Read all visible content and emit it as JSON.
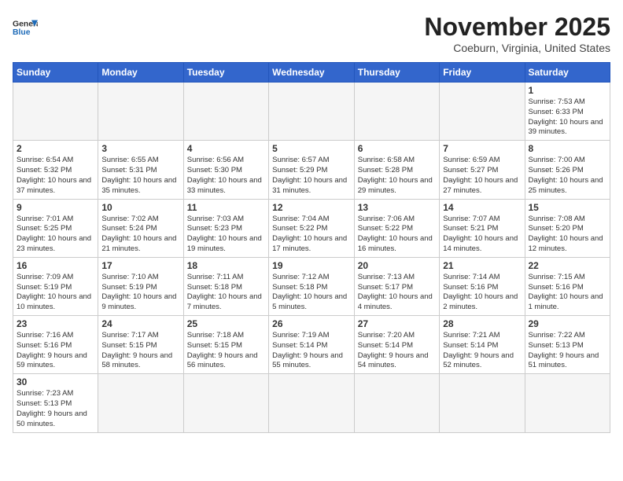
{
  "header": {
    "logo_general": "General",
    "logo_blue": "Blue",
    "month": "November 2025",
    "location": "Coeburn, Virginia, United States"
  },
  "weekdays": [
    "Sunday",
    "Monday",
    "Tuesday",
    "Wednesday",
    "Thursday",
    "Friday",
    "Saturday"
  ],
  "weeks": [
    [
      {
        "day": "",
        "info": ""
      },
      {
        "day": "",
        "info": ""
      },
      {
        "day": "",
        "info": ""
      },
      {
        "day": "",
        "info": ""
      },
      {
        "day": "",
        "info": ""
      },
      {
        "day": "",
        "info": ""
      },
      {
        "day": "1",
        "info": "Sunrise: 7:53 AM\nSunset: 6:33 PM\nDaylight: 10 hours\nand 39 minutes."
      }
    ],
    [
      {
        "day": "2",
        "info": "Sunrise: 6:54 AM\nSunset: 5:32 PM\nDaylight: 10 hours\nand 37 minutes."
      },
      {
        "day": "3",
        "info": "Sunrise: 6:55 AM\nSunset: 5:31 PM\nDaylight: 10 hours\nand 35 minutes."
      },
      {
        "day": "4",
        "info": "Sunrise: 6:56 AM\nSunset: 5:30 PM\nDaylight: 10 hours\nand 33 minutes."
      },
      {
        "day": "5",
        "info": "Sunrise: 6:57 AM\nSunset: 5:29 PM\nDaylight: 10 hours\nand 31 minutes."
      },
      {
        "day": "6",
        "info": "Sunrise: 6:58 AM\nSunset: 5:28 PM\nDaylight: 10 hours\nand 29 minutes."
      },
      {
        "day": "7",
        "info": "Sunrise: 6:59 AM\nSunset: 5:27 PM\nDaylight: 10 hours\nand 27 minutes."
      },
      {
        "day": "8",
        "info": "Sunrise: 7:00 AM\nSunset: 5:26 PM\nDaylight: 10 hours\nand 25 minutes."
      }
    ],
    [
      {
        "day": "9",
        "info": "Sunrise: 7:01 AM\nSunset: 5:25 PM\nDaylight: 10 hours\nand 23 minutes."
      },
      {
        "day": "10",
        "info": "Sunrise: 7:02 AM\nSunset: 5:24 PM\nDaylight: 10 hours\nand 21 minutes."
      },
      {
        "day": "11",
        "info": "Sunrise: 7:03 AM\nSunset: 5:23 PM\nDaylight: 10 hours\nand 19 minutes."
      },
      {
        "day": "12",
        "info": "Sunrise: 7:04 AM\nSunset: 5:22 PM\nDaylight: 10 hours\nand 17 minutes."
      },
      {
        "day": "13",
        "info": "Sunrise: 7:06 AM\nSunset: 5:22 PM\nDaylight: 10 hours\nand 16 minutes."
      },
      {
        "day": "14",
        "info": "Sunrise: 7:07 AM\nSunset: 5:21 PM\nDaylight: 10 hours\nand 14 minutes."
      },
      {
        "day": "15",
        "info": "Sunrise: 7:08 AM\nSunset: 5:20 PM\nDaylight: 10 hours\nand 12 minutes."
      }
    ],
    [
      {
        "day": "16",
        "info": "Sunrise: 7:09 AM\nSunset: 5:19 PM\nDaylight: 10 hours\nand 10 minutes."
      },
      {
        "day": "17",
        "info": "Sunrise: 7:10 AM\nSunset: 5:19 PM\nDaylight: 10 hours\nand 9 minutes."
      },
      {
        "day": "18",
        "info": "Sunrise: 7:11 AM\nSunset: 5:18 PM\nDaylight: 10 hours\nand 7 minutes."
      },
      {
        "day": "19",
        "info": "Sunrise: 7:12 AM\nSunset: 5:18 PM\nDaylight: 10 hours\nand 5 minutes."
      },
      {
        "day": "20",
        "info": "Sunrise: 7:13 AM\nSunset: 5:17 PM\nDaylight: 10 hours\nand 4 minutes."
      },
      {
        "day": "21",
        "info": "Sunrise: 7:14 AM\nSunset: 5:16 PM\nDaylight: 10 hours\nand 2 minutes."
      },
      {
        "day": "22",
        "info": "Sunrise: 7:15 AM\nSunset: 5:16 PM\nDaylight: 10 hours\nand 1 minute."
      }
    ],
    [
      {
        "day": "23",
        "info": "Sunrise: 7:16 AM\nSunset: 5:16 PM\nDaylight: 9 hours\nand 59 minutes."
      },
      {
        "day": "24",
        "info": "Sunrise: 7:17 AM\nSunset: 5:15 PM\nDaylight: 9 hours\nand 58 minutes."
      },
      {
        "day": "25",
        "info": "Sunrise: 7:18 AM\nSunset: 5:15 PM\nDaylight: 9 hours\nand 56 minutes."
      },
      {
        "day": "26",
        "info": "Sunrise: 7:19 AM\nSunset: 5:14 PM\nDaylight: 9 hours\nand 55 minutes."
      },
      {
        "day": "27",
        "info": "Sunrise: 7:20 AM\nSunset: 5:14 PM\nDaylight: 9 hours\nand 54 minutes."
      },
      {
        "day": "28",
        "info": "Sunrise: 7:21 AM\nSunset: 5:14 PM\nDaylight: 9 hours\nand 52 minutes."
      },
      {
        "day": "29",
        "info": "Sunrise: 7:22 AM\nSunset: 5:13 PM\nDaylight: 9 hours\nand 51 minutes."
      }
    ],
    [
      {
        "day": "30",
        "info": "Sunrise: 7:23 AM\nSunset: 5:13 PM\nDaylight: 9 hours\nand 50 minutes."
      },
      {
        "day": "",
        "info": ""
      },
      {
        "day": "",
        "info": ""
      },
      {
        "day": "",
        "info": ""
      },
      {
        "day": "",
        "info": ""
      },
      {
        "day": "",
        "info": ""
      },
      {
        "day": "",
        "info": ""
      }
    ]
  ]
}
